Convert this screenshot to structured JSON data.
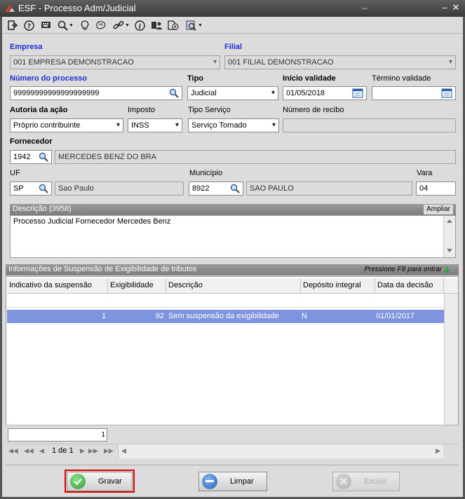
{
  "window": {
    "title": "ESF - Processo Adm/Judicial"
  },
  "toolbar": {
    "icons": [
      "exit-icon",
      "help-icon",
      "keyboard-icon",
      "search-icon",
      "bulb-icon",
      "map-icon",
      "link-icon",
      "info-icon",
      "user-icon",
      "add-document-icon",
      "report-icon"
    ]
  },
  "form": {
    "empresa_label": "Empresa",
    "empresa_value": "001 EMPRESA DEMONSTRACAO",
    "filial_label": "Filial",
    "filial_value": "001 FILIAL DEMONSTRACAO",
    "numero_label": "Número do processo",
    "numero_value": "99999999999999999999",
    "tipo_label": "Tipo",
    "tipo_value": "Judicial",
    "inicio_label": "Início validade",
    "inicio_value": "01/05/2018",
    "termino_label": "Término validade",
    "termino_value": "",
    "autoria_label": "Autoria da ação",
    "autoria_value": "Próprio contribuinte",
    "imposto_label": "Imposto",
    "imposto_value": "INSS",
    "tiposervico_label": "Tipo Serviço",
    "tiposervico_value": "Serviço Tomado",
    "recibo_label": "Número de recibo",
    "recibo_value": "",
    "fornecedor_label": "Fornecedor",
    "fornecedor_code": "1942",
    "fornecedor_name": "MERCEDES BENZ DO BRA",
    "uf_label": "UF",
    "uf_code": "SP",
    "uf_name": "Sao Paulo",
    "municipio_label": "Município",
    "municipio_code": "8922",
    "municipio_name": "SAO PAULO",
    "vara_label": "Vara",
    "vara_value": "04"
  },
  "description": {
    "header": "Descrição (3958)",
    "expand_label": "Ampliar",
    "text": "Processo Judicial Fornecedor Mercedes Benz"
  },
  "suspension": {
    "header": "Informações de Suspensão de Exigibilidade de tributos",
    "hint": "Pressione F8 para entrar",
    "columns": [
      "Indicativo da suspensão",
      "Exigibilidade",
      "Descrição",
      "Depósito integral",
      "Data da decisão"
    ],
    "rows": [
      {
        "indicativo": "1",
        "exigibilidade": "92",
        "descricao": "Sem suspensão da exigibilidade",
        "deposito": "N",
        "data": "01/01/2017"
      }
    ],
    "count": "1",
    "page_label": "1 de 1"
  },
  "buttons": {
    "save": "Gravar",
    "clear": "Limpar",
    "delete": "Excluir"
  },
  "colors": {
    "label_blue": "#1e2fd0",
    "selected_row": "#7e94de",
    "save_highlight": "#e00000"
  }
}
